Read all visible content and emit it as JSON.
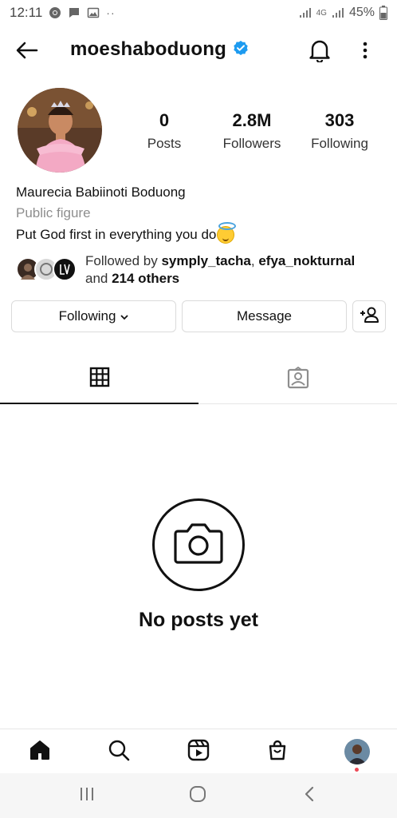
{
  "status_bar": {
    "time": "12:11",
    "network": "4G",
    "battery": "45%",
    "icons": [
      "chrome-icon",
      "message-icon",
      "gallery-icon",
      "more-dots-icon",
      "wifi-signal-icon",
      "cell-signal-icon",
      "battery-icon"
    ]
  },
  "header": {
    "username": "moeshaboduong",
    "verified": true,
    "icons": [
      "back-arrow-icon",
      "verified-badge-icon",
      "bell-icon",
      "more-vertical-icon"
    ]
  },
  "profile": {
    "stats": [
      {
        "value": "0",
        "label": "Posts"
      },
      {
        "value": "2.8M",
        "label": "Followers"
      },
      {
        "value": "303",
        "label": "Following"
      }
    ],
    "full_name": "Maurecia Babiinoti Boduong",
    "category": "Public figure",
    "bio": "Put God first in everything you do",
    "followed_by": {
      "prefix": "Followed by ",
      "user1": "symply_tacha",
      "separator": ", ",
      "user2": "efya_nokturnal",
      "line2_prefix": "and ",
      "others": "214 others"
    }
  },
  "actions": {
    "following_label": "Following",
    "message_label": "Message"
  },
  "tabs": [
    "grid-icon",
    "tagged-icon"
  ],
  "empty_state": {
    "title": "No posts yet"
  },
  "bottom_nav": [
    "home-icon",
    "search-icon",
    "reels-icon",
    "shop-icon",
    "profile-avatar"
  ],
  "colors": {
    "accent": "#1d9bf0",
    "notification_dot": "#ed4956",
    "border": "#dbdbdb"
  }
}
